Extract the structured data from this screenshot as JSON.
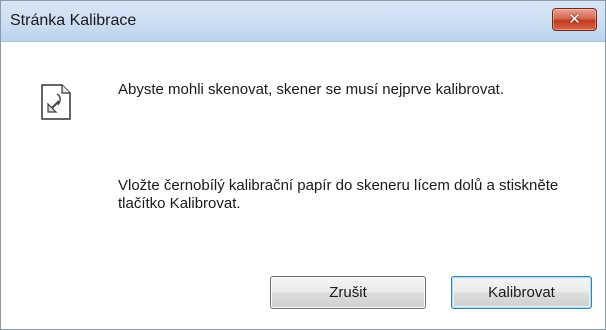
{
  "window": {
    "title": "Stránka Kalibrace"
  },
  "titlebar": {
    "close_icon": "close-icon"
  },
  "content": {
    "icon": "document-arrow-icon",
    "message_1": "Abyste mohli skenovat, skener se musí nejprve kalibrovat.",
    "message_2": "Vložte černobílý kalibrační papír do skeneru lícem dolů a stiskněte tlačítko Kalibrovat."
  },
  "buttons": {
    "cancel_label": "Zrušit",
    "calibrate_label": "Kalibrovat"
  },
  "colors": {
    "titlebar": "#cfe0f3",
    "close_button": "#c23a1d",
    "default_button_border": "#3c7fb1"
  }
}
